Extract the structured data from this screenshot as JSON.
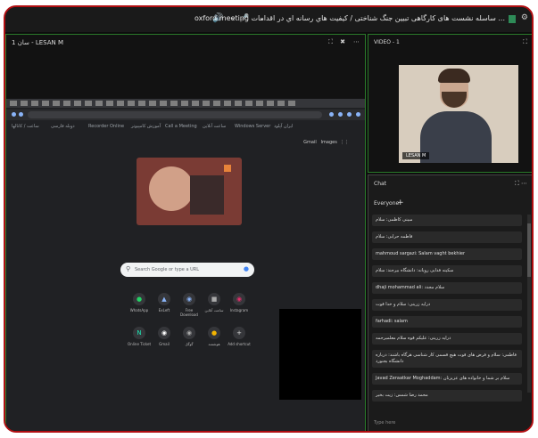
{
  "topbar": {
    "title": "oxford meeting ساسله نشست های کارگاهی تبیین جنگ شناختی / کیفیت هاي رسانه اي در اقدامات ...",
    "mic_icon": "mic-icon",
    "speaker_icon": "speaker-icon",
    "settings_icon": "gear-icon"
  },
  "share": {
    "label": "سان 1 - LESAN M"
  },
  "browser": {
    "search_placeholder": "Search Google or type a URL",
    "bookmarks": [
      "ساعت / کانالها",
      "دوبله فارسی",
      "Recorder Online",
      "آموزش کامپیوتر",
      "Call a Meeting",
      "ساعت آنلاین",
      "Windows Server",
      "ایران آپلود"
    ],
    "header_links": [
      "Gmail",
      "Images"
    ],
    "shortcuts_row1": [
      "WhatsApp",
      "ExLeft",
      "Free Download",
      "ساعت آنلاین",
      "Instagram"
    ],
    "shortcuts_row2": [
      "Online Ticket",
      "Gmail",
      "گوگل",
      "هوشمند",
      "Add shortcut"
    ]
  },
  "video": {
    "label": "VIDEO - 1",
    "caption": "LESAN M"
  },
  "chat": {
    "title": "Chat",
    "tab": "Everyone",
    "messages": [
      "مبینی کاظمی: سلام",
      "فاطمه حرابی: سلام",
      "mahmoud sargazi: Salam vaght bekhier",
      "سکینه فدایی رویانه: دانشگاه بیرجند: سلام",
      "dhaji mohammad ali: سلام مجدد",
      "درایه زرینی: سلام و خدا قوت",
      "farhadi: salam",
      "درایه زرینی: علیکم قوه سلام معلمبرحمه",
      "فاطمی: سلام و فرض های قوت هیچ قسمی کار شناسی هرگاه باشند: درباره دانشگاه بجنورد",
      "Javad Zeraatkar Moghaddam: سلام بر شما و خانواده های عزیزتان",
      "محمد رضا شمس: زیت بخیر"
    ],
    "input_placeholder": "Type here"
  }
}
